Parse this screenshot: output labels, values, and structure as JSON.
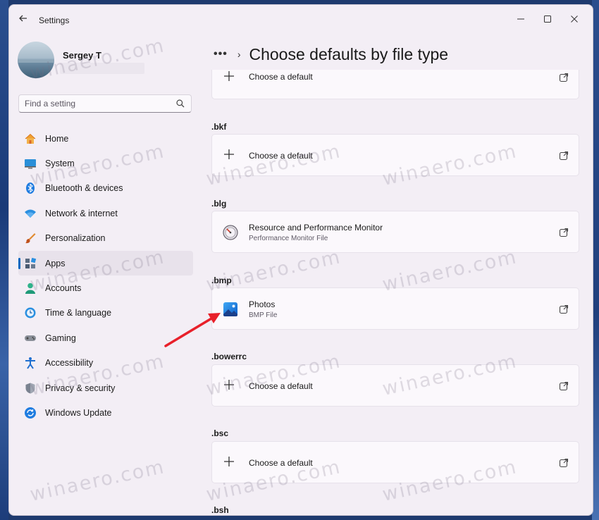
{
  "window": {
    "title": "Settings"
  },
  "user": {
    "name": "Sergey T"
  },
  "search": {
    "placeholder": "Find a setting"
  },
  "sidebar": {
    "items": [
      {
        "label": "Home",
        "icon": "home-icon",
        "selected": false
      },
      {
        "label": "System",
        "icon": "system-icon",
        "selected": false
      },
      {
        "label": "Bluetooth & devices",
        "icon": "bluetooth-icon",
        "selected": false
      },
      {
        "label": "Network & internet",
        "icon": "network-icon",
        "selected": false
      },
      {
        "label": "Personalization",
        "icon": "brush-icon",
        "selected": false
      },
      {
        "label": "Apps",
        "icon": "apps-icon",
        "selected": true
      },
      {
        "label": "Accounts",
        "icon": "accounts-icon",
        "selected": false
      },
      {
        "label": "Time & language",
        "icon": "time-language-icon",
        "selected": false
      },
      {
        "label": "Gaming",
        "icon": "gaming-icon",
        "selected": false
      },
      {
        "label": "Accessibility",
        "icon": "accessibility-icon",
        "selected": false
      },
      {
        "label": "Privacy & security",
        "icon": "shield-icon",
        "selected": false
      },
      {
        "label": "Windows Update",
        "icon": "update-icon",
        "selected": false
      }
    ]
  },
  "header": {
    "dots": "•••",
    "chevron": "›",
    "title": "Choose defaults by file type"
  },
  "file_types": [
    {
      "ext": "",
      "app": "Choose a default",
      "desc": ""
    },
    {
      "ext": ".bkf",
      "app": "Choose a default",
      "desc": ""
    },
    {
      "ext": ".blg",
      "app": "Resource and Performance Monitor",
      "desc": "Performance Monitor File"
    },
    {
      "ext": ".bmp",
      "app": "Photos",
      "desc": "BMP File"
    },
    {
      "ext": ".bowerrc",
      "app": "Choose a default",
      "desc": ""
    },
    {
      "ext": ".bsc",
      "app": "Choose a default",
      "desc": ""
    },
    {
      "ext": ".bsh",
      "app": "",
      "desc": ""
    }
  ],
  "watermark": "winaero.com",
  "colors": {
    "accent": "#0067c0",
    "arrow": "#e8202a",
    "window_bg": "#f3eef5"
  }
}
